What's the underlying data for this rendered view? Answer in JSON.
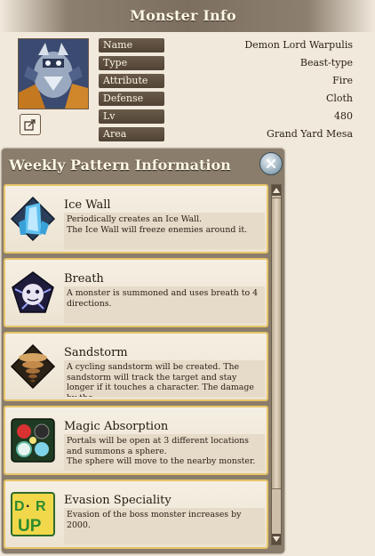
{
  "monster_info": {
    "title": "Monster Info",
    "rows": [
      {
        "label": "Name",
        "value": "Demon Lord Warpulis"
      },
      {
        "label": "Type",
        "value": "Beast-type"
      },
      {
        "label": "Attribute",
        "value": "Fire"
      },
      {
        "label": "Defense type",
        "value": "Cloth"
      },
      {
        "label": "Lv",
        "value": "480"
      },
      {
        "label": "Area",
        "value": "Grand Yard Mesa"
      }
    ]
  },
  "weekly": {
    "title": "Weekly Pattern Information",
    "patterns": [
      {
        "title": "Ice Wall",
        "desc_lines": [
          "Periodically creates an Ice Wall.",
          "The Ice Wall will freeze enemies around it."
        ],
        "icon": "ice-wall-icon"
      },
      {
        "title": "Breath",
        "desc_lines": [
          "A monster is summoned and uses breath to 4 directions."
        ],
        "icon": "breath-icon"
      },
      {
        "title": "Sandstorm",
        "desc_lines": [
          "A cycling sandstorm will be created. The sandstorm will track the target and stay longer if it touches a character. The damage by the"
        ],
        "icon": "sandstorm-icon"
      },
      {
        "title": "Magic Absorption",
        "desc_lines": [
          "Portals will be open at 3 different locations and summons a sphere.",
          "The sphere will move to the nearby monster."
        ],
        "icon": "magic-absorption-icon"
      },
      {
        "title": "Evasion Speciality",
        "desc_lines": [
          "Evasion of the boss monster increases by 2000."
        ],
        "icon": "evasion-icon",
        "icon_text": [
          "D",
          "R",
          "UP"
        ]
      }
    ]
  },
  "colors": {
    "panel": "#8a7d6b",
    "card_border": "#e7c469",
    "label_bg": "#5e4f40"
  }
}
